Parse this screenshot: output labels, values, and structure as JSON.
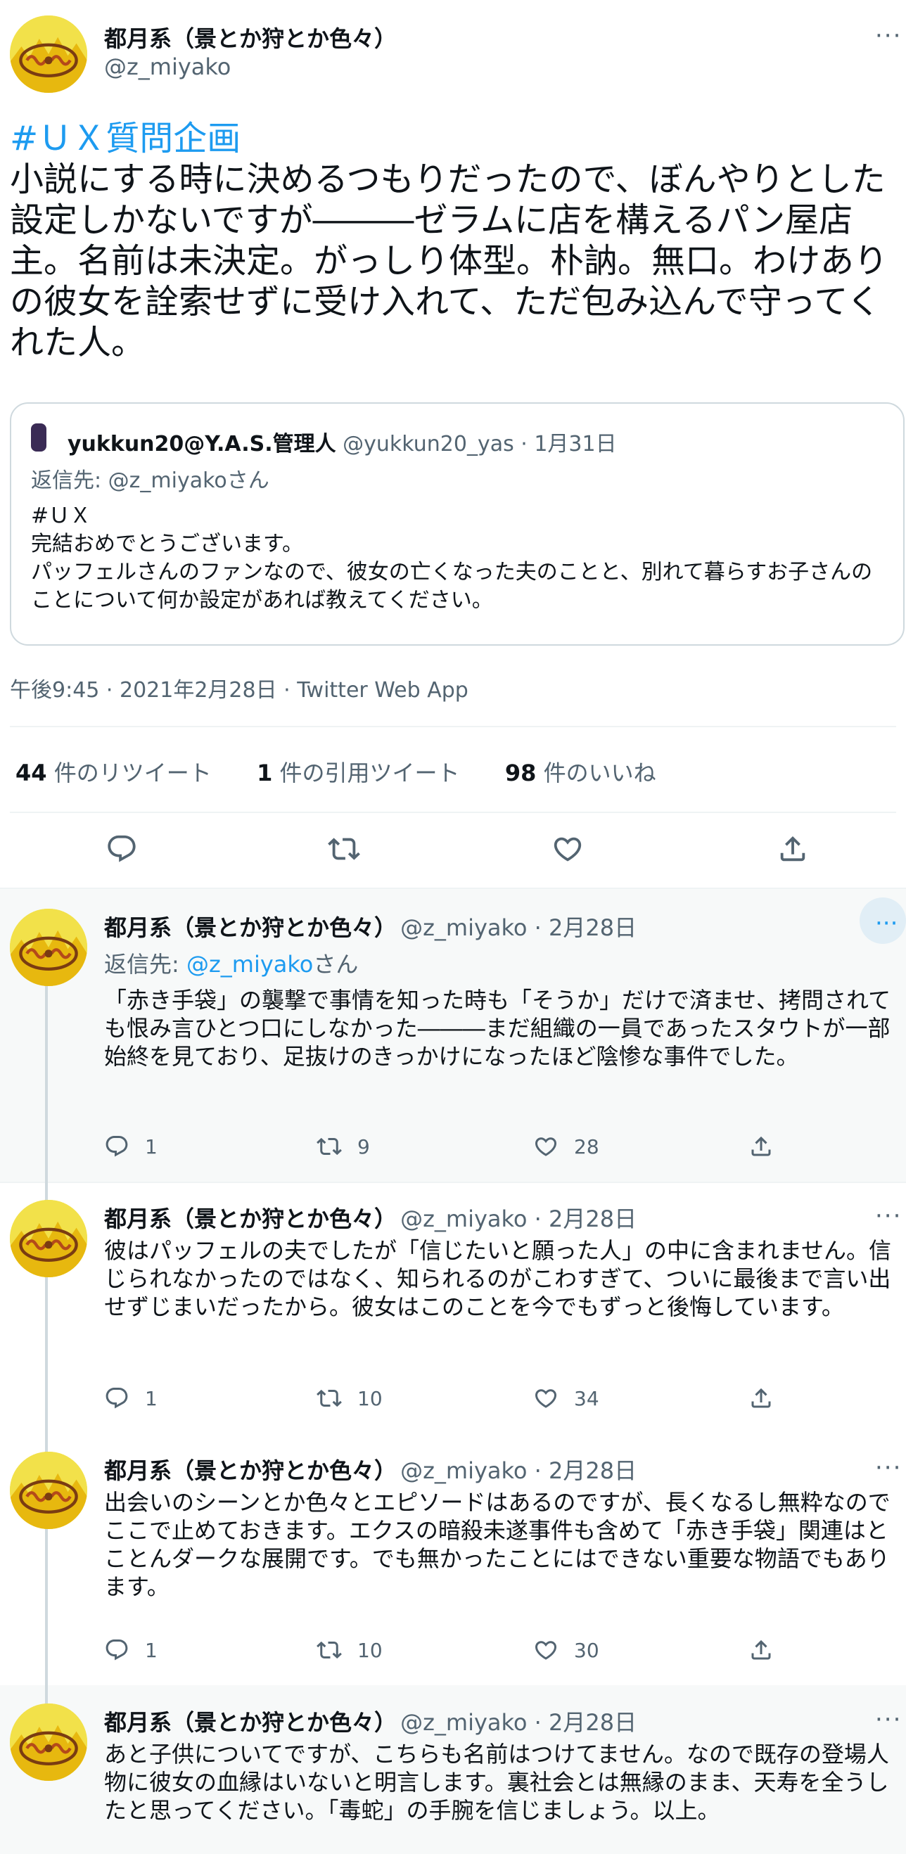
{
  "main_tweet": {
    "author_name": "都月系（景とか狩とか色々）",
    "author_handle": "@z_miyako",
    "more_label": "···",
    "hashtag": "#ＵＸ質問企画",
    "text": "小説にする時に決めるつもりだったので、ぼんやりとした設定しかないですが―――ゼラムに店を構えるパン屋店主。名前は未決定。がっしり体型。朴訥。無口。わけありの彼女を詮索せずに受け入れて、ただ包み込んで守ってくれた人。",
    "meta": "午後9:45 · 2021年2月28日 · Twitter Web App",
    "stats": [
      {
        "count": "44",
        "label": "件のリツイート"
      },
      {
        "count": "1",
        "label": "件の引用ツイート"
      },
      {
        "count": "98",
        "label": "件のいいね"
      }
    ]
  },
  "quoted_tweet": {
    "author_name": "yukkun20@Y.A.S.管理人",
    "author_handle": "@yukkun20_yas · 1月31日",
    "reply_prefix": "返信先: ",
    "reply_handle": "@z_miyako",
    "reply_suffix": "さん",
    "text_line1": "#ＵＸ",
    "text_line2": "完結おめでとうございます。",
    "text_line3": "パッフェルさんのファンなので、彼女の亡くなった夫のことと、別れて暮らすお子さんのことについて何か設定があれば教えてください。"
  },
  "replies": [
    {
      "author_name": "都月系（景とか狩とか色々）",
      "author_meta": "@z_miyako · 2月28日",
      "reply_prefix": "返信先: ",
      "reply_handle": "@z_miyako",
      "reply_suffix": "さん",
      "text": "「赤き手袋」の襲撃で事情を知った時も「そうか」だけで済ませ、拷問されても恨み言ひとつ口にしなかった―――まだ組織の一員であったスタウトが一部始終を見ており、足抜けのきっかけになったほど陰惨な事件でした。",
      "reply_count": "1",
      "retweet_count": "9",
      "like_count": "28"
    },
    {
      "author_name": "都月系（景とか狩とか色々）",
      "author_meta": "@z_miyako · 2月28日",
      "text": "彼はパッフェルの夫でしたが「信じたいと願った人」の中に含まれません。信じられなかったのではなく、知られるのがこわすぎて、ついに最後まで言い出せずじまいだったから。彼女はこのことを今でもずっと後悔しています。",
      "reply_count": "1",
      "retweet_count": "10",
      "like_count": "34"
    },
    {
      "author_name": "都月系（景とか狩とか色々）",
      "author_meta": "@z_miyako · 2月28日",
      "text": "出会いのシーンとか色々とエピソードはあるのですが、長くなるし無粋なのでここで止めておきます。エクスの暗殺未遂事件も含めて「赤き手袋」関連はとことんダークな展開です。でも無かったことにはできない重要な物語でもあります。",
      "reply_count": "1",
      "retweet_count": "10",
      "like_count": "30"
    },
    {
      "author_name": "都月系（景とか狩とか色々）",
      "author_meta": "@z_miyako · 2月28日",
      "text": "あと子供についてですが、こちらも名前はつけてません。なので既存の登場人物に彼女の血縁はいないと明言します。裏社会とは無縁のまま、天寿を全うしたと思ってください。「毒蛇」の手腕を信じましょう。以上。"
    }
  ],
  "colors": {
    "link": "#1d9bf0",
    "secondary_text": "#536471",
    "hover_bg": "#f7f9f9",
    "avatar_yellow": "#f2e14a"
  },
  "icons": [
    "reply-icon",
    "retweet-icon",
    "like-icon",
    "share-icon",
    "more-icon"
  ]
}
